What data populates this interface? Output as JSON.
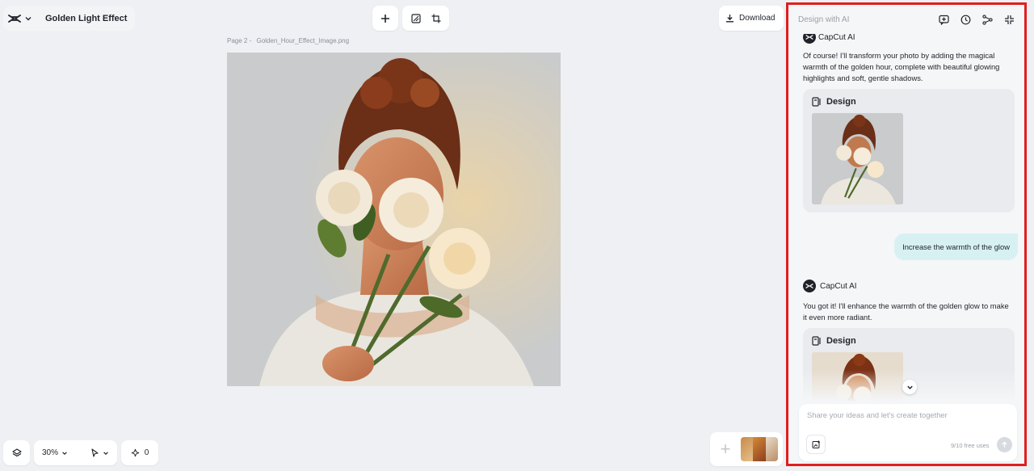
{
  "app": {
    "title": "Golden Light Effect",
    "logo_icon": "capcut-logo-icon"
  },
  "toolbar": {
    "add_icon": "plus-icon",
    "resize_icon": "resize-icon",
    "crop_icon": "crop-icon",
    "download_label": "Download"
  },
  "canvas": {
    "page_label": "Page 2 -",
    "file_name": "Golden_Hour_Effect_Image.png"
  },
  "bottom": {
    "zoom": "30%",
    "points": "0"
  },
  "panel": {
    "title": "Design with AI",
    "header_icons": [
      "new-chat-icon",
      "history-icon",
      "share-icon",
      "collapse-icon"
    ],
    "messages": [
      {
        "role": "ai",
        "name": "CapCut AI",
        "text": "Of course! I'll transform your photo by adding the magical warmth of the golden hour, complete with beautiful glowing highlights and soft, gentle shadows.",
        "card_label": "Design"
      },
      {
        "role": "user",
        "text": "Increase the warmth of the glow"
      },
      {
        "role": "ai",
        "name": "CapCut AI",
        "text": "You got it! I'll enhance the warmth of the golden glow to make it even more radiant.",
        "card_label": "Design"
      }
    ],
    "input_placeholder": "Share your ideas and let's create together",
    "free_uses": "9/10 free uses"
  },
  "colors": {
    "accent_border": "#e01e1e",
    "user_bubble": "#d7f1f3"
  }
}
